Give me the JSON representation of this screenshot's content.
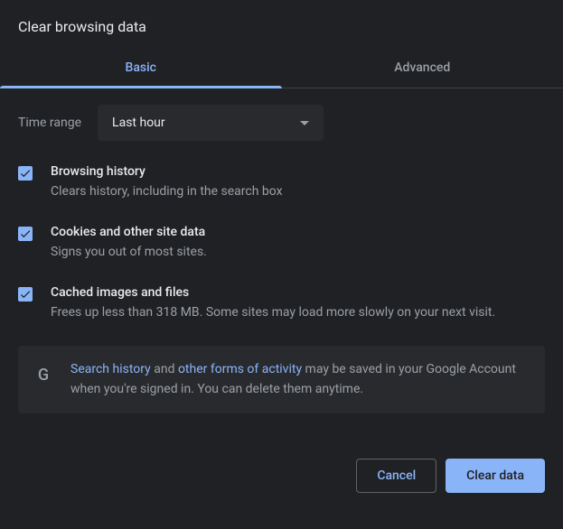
{
  "title": "Clear browsing data",
  "tabs": {
    "basic": "Basic",
    "advanced": "Advanced"
  },
  "timeRange": {
    "label": "Time range",
    "value": "Last hour"
  },
  "options": [
    {
      "title": "Browsing history",
      "desc": "Clears history, including in the search box"
    },
    {
      "title": "Cookies and other site data",
      "desc": "Signs you out of most sites."
    },
    {
      "title": "Cached images and files",
      "desc": "Frees up less than 318 MB. Some sites may load more slowly on your next visit."
    }
  ],
  "info": {
    "link1": "Search history",
    "mid1": " and ",
    "link2": "other forms of activity",
    "rest": " may be saved in your Google Account when you're signed in. You can delete them anytime."
  },
  "buttons": {
    "cancel": "Cancel",
    "clear": "Clear data"
  }
}
